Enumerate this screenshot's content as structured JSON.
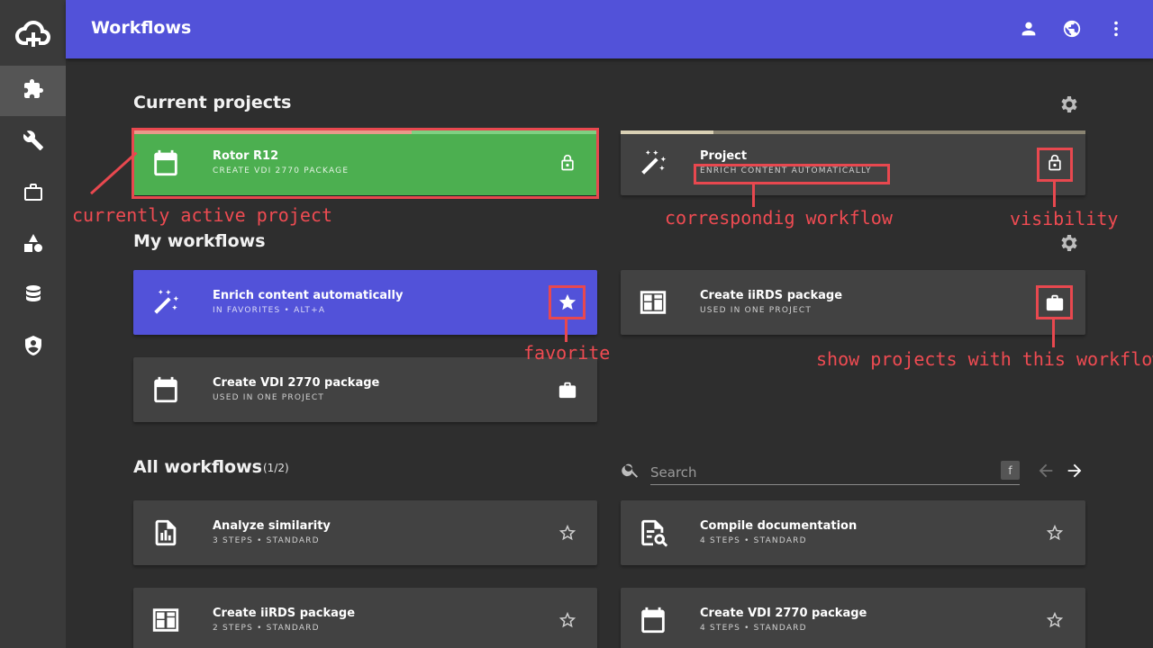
{
  "header": {
    "title": "Workflows",
    "icons": [
      "account-icon",
      "globe-icon",
      "more-vert-icon"
    ]
  },
  "sidebar": {
    "items": [
      {
        "name": "workflows",
        "icon": "puzzle-icon",
        "active": true
      },
      {
        "name": "tools",
        "icon": "wrench-icon",
        "active": false
      },
      {
        "name": "projects",
        "icon": "briefcase-icon",
        "active": false
      },
      {
        "name": "shapes",
        "icon": "shapes-icon",
        "active": false
      },
      {
        "name": "database",
        "icon": "database-icon",
        "active": false
      },
      {
        "name": "security",
        "icon": "shield-icon",
        "active": false
      }
    ]
  },
  "current_projects": {
    "title": "Current projects",
    "cards": [
      {
        "title": "Rotor R12",
        "subtitle": "CREATE VDI 2770 PACKAGE",
        "icon": "calendar-icon",
        "action_icon": "lock-icon",
        "color": "#4caf50",
        "progress": 0.6
      },
      {
        "title": "Project",
        "subtitle": "ENRICH CONTENT AUTOMATICALLY",
        "icon": "magic-wand-icon",
        "action_icon": "lock-icon",
        "progress": 0.2
      }
    ]
  },
  "my_workflows": {
    "title": "My workflows",
    "cards": [
      {
        "title": "Enrich content automatically",
        "subtitle": "IN FAVORITES • ALT+A",
        "icon": "magic-wand-icon",
        "action_icon": "star-icon",
        "color": "#5252d9"
      },
      {
        "title": "Create iiRDS package",
        "subtitle": "USED IN ONE PROJECT",
        "icon": "dashboard-icon",
        "action_icon": "briefcase-icon"
      },
      {
        "title": "Create VDI 2770 package",
        "subtitle": "USED IN ONE PROJECT",
        "icon": "calendar-icon",
        "action_icon": "briefcase-icon"
      }
    ]
  },
  "all_workflows": {
    "title": "All workflows",
    "count": "(1/2)",
    "search_placeholder": "Search",
    "shortcut_key": "f",
    "cards": [
      {
        "title": "Analyze similarity",
        "subtitle": "3 STEPS • STANDARD",
        "icon": "chart-file-icon",
        "action_icon": "star-outline-icon"
      },
      {
        "title": "Compile documentation",
        "subtitle": "4 STEPS • STANDARD",
        "icon": "file-search-icon",
        "action_icon": "star-outline-icon"
      },
      {
        "title": "Create iiRDS package",
        "subtitle": "2 STEPS • STANDARD",
        "icon": "dashboard-icon",
        "action_icon": "star-outline-icon"
      },
      {
        "title": "Create VDI 2770 package",
        "subtitle": "4 STEPS • STANDARD",
        "icon": "calendar-icon",
        "action_icon": "star-outline-icon"
      }
    ]
  },
  "annotations": {
    "active_project": "currently active project",
    "workflow": "correspondig workflow",
    "visibility": "visibility",
    "favorite": "favorite",
    "show_projects": "show projects with this workflow"
  },
  "colors": {
    "accent": "#5252d9",
    "active_green": "#4caf50",
    "annotation_red": "#e8484f",
    "background": "#2e2e2e",
    "card": "#424242"
  }
}
